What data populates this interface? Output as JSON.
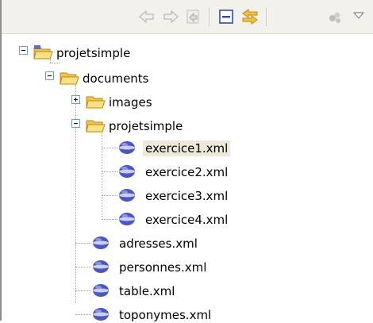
{
  "toolbar": {
    "buttons": [
      {
        "name": "back-icon"
      },
      {
        "name": "forward-icon"
      },
      {
        "name": "go-into-icon"
      },
      {
        "name": "collapse-all-icon"
      },
      {
        "name": "link-with-editor-icon"
      },
      {
        "name": "menu-icon"
      },
      {
        "name": "view-menu-dropdown-icon"
      }
    ]
  },
  "tree": {
    "root": {
      "label": "projetsimple",
      "expanded": true
    },
    "documents": {
      "label": "documents",
      "expanded": true
    },
    "images": {
      "label": "images",
      "expanded": false
    },
    "sub_project": {
      "label": "projetsimple",
      "expanded": true
    },
    "files_nested": [
      {
        "label": "exercice1.xml",
        "selected": true
      },
      {
        "label": "exercice2.xml"
      },
      {
        "label": "exercice3.xml"
      },
      {
        "label": "exercice4.xml"
      }
    ],
    "files_documents": [
      {
        "label": "adresses.xml"
      },
      {
        "label": "personnes.xml"
      },
      {
        "label": "table.xml"
      },
      {
        "label": "toponymes.xml"
      }
    ]
  },
  "colors": {
    "folder": "#f6c343",
    "xml_icon": "#4a56c8",
    "selection": "#ece9d8"
  }
}
